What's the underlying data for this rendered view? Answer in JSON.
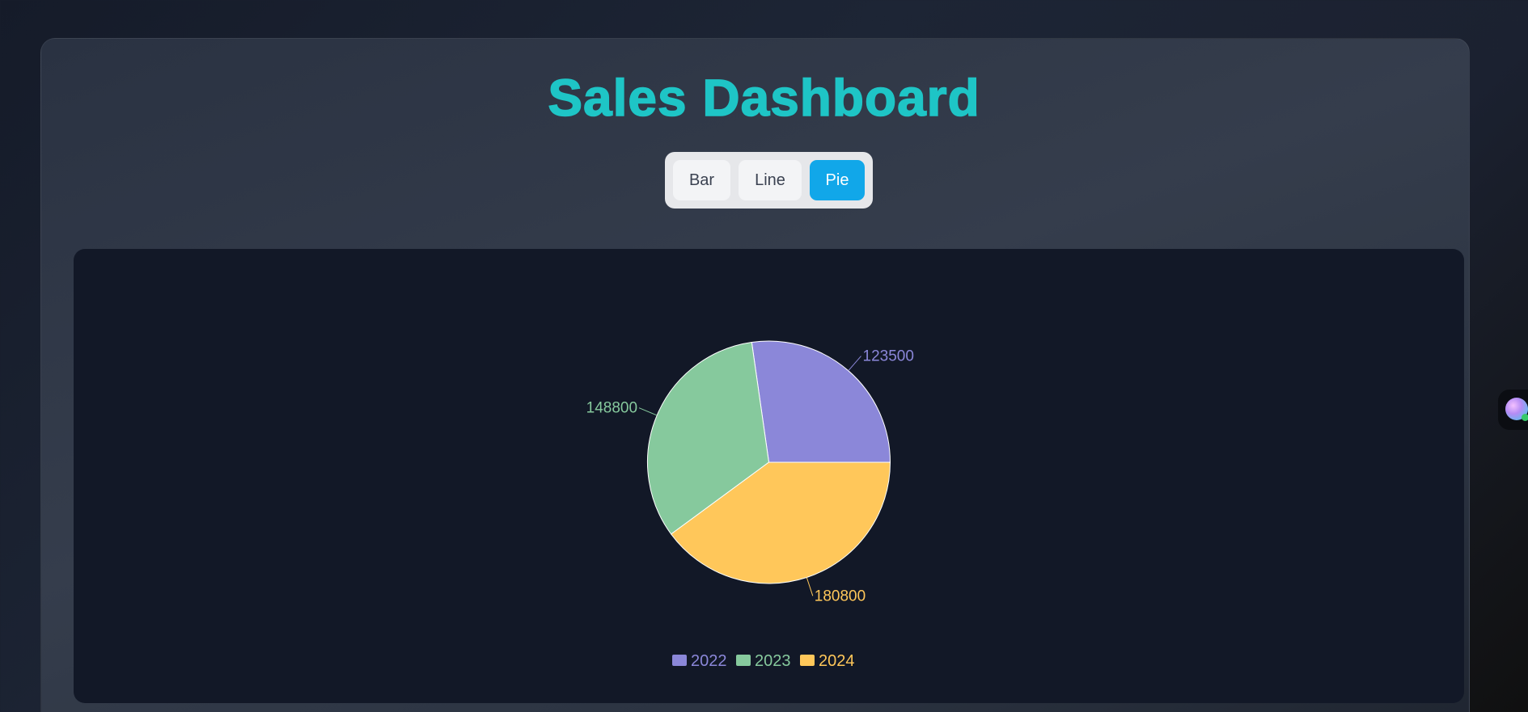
{
  "page": {
    "title": "Sales Dashboard"
  },
  "toggle": {
    "buttons": [
      {
        "label": "Bar",
        "active": false
      },
      {
        "label": "Line",
        "active": false
      },
      {
        "label": "Pie",
        "active": true
      }
    ]
  },
  "colors": {
    "accent_title": "#1ec5c6",
    "active_button": "#11a7e9",
    "panel_bg": "#121827",
    "slice_stroke": "#ffffff"
  },
  "chart_data": {
    "type": "pie",
    "title": "",
    "categories": [
      "2022",
      "2023",
      "2024"
    ],
    "values": [
      123500,
      148800,
      180800
    ],
    "colors": [
      "#8b87d9",
      "#86c99d",
      "#ffc75a"
    ],
    "data_labels": [
      "123500",
      "148800",
      "180800"
    ],
    "legend": {
      "position": "bottom",
      "entries": [
        "2022",
        "2023",
        "2024"
      ]
    }
  },
  "side_widget": {
    "icon": "assistant-orb-icon"
  }
}
